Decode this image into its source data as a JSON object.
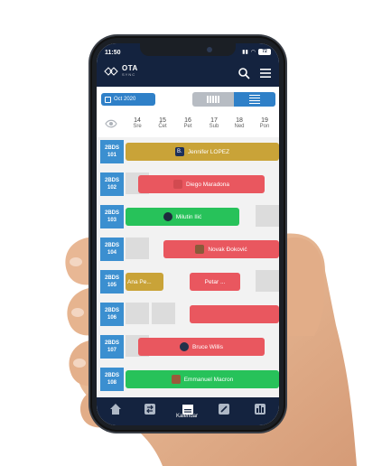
{
  "status": {
    "time": "11:50",
    "battery": "72"
  },
  "app": {
    "logo_text": "OTA",
    "logo_sub": "SYNC"
  },
  "toolbar": {
    "date_label": "Oct 2020"
  },
  "days": [
    {
      "num": "14",
      "name": "Sre"
    },
    {
      "num": "15",
      "name": "Čet"
    },
    {
      "num": "16",
      "name": "Pet"
    },
    {
      "num": "17",
      "name": "Sub"
    },
    {
      "num": "18",
      "name": "Ned"
    },
    {
      "num": "19",
      "name": "Pon"
    }
  ],
  "rooms": [
    {
      "line1": "2BDS",
      "line2": "101"
    },
    {
      "line1": "2BDS",
      "line2": "102"
    },
    {
      "line1": "2BDS",
      "line2": "103"
    },
    {
      "line1": "2BDS",
      "line2": "104"
    },
    {
      "line1": "2BDS",
      "line2": "105"
    },
    {
      "line1": "2BDS",
      "line2": "106"
    },
    {
      "line1": "2BDS",
      "line2": "107"
    },
    {
      "line1": "2BDS",
      "line2": "108"
    }
  ],
  "reservations": {
    "r101": "Jennifer LOPEZ",
    "r101_badge": "B.",
    "r102": "Diego Maradona",
    "r103": "Milutin Ilić",
    "r104": "Novak Đoković",
    "r105a": "Ana Pe...",
    "r105b": "Petar ...",
    "r107": "Bruce Willis",
    "r108": "Emmanuel Macron"
  },
  "tabbar": {
    "active_label": "Kalendar"
  },
  "colors": {
    "navy": "#14233f",
    "blue": "#2f80c8",
    "gold": "#c9a338",
    "red": "#e9575f",
    "green": "#27c25a"
  }
}
